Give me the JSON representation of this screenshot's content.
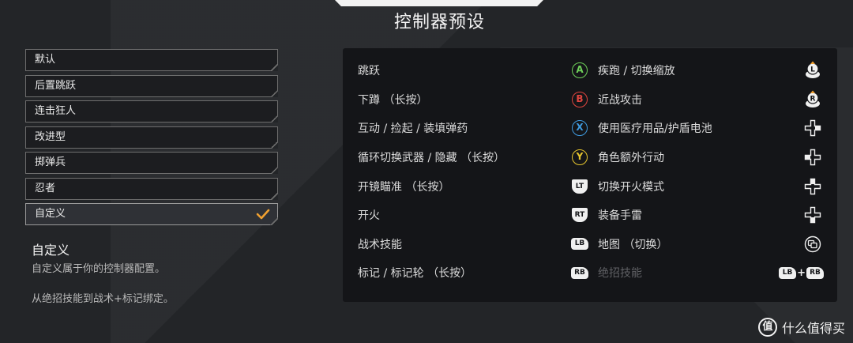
{
  "title": "控制器预设",
  "presets": [
    {
      "label": "默认"
    },
    {
      "label": "后置跳跃"
    },
    {
      "label": "连击狂人"
    },
    {
      "label": "改进型"
    },
    {
      "label": "掷弹兵"
    },
    {
      "label": "忍者"
    },
    {
      "label": "自定义",
      "selected": true
    }
  ],
  "accent_color": "#f0a030",
  "description": {
    "title": "自定义",
    "text": "自定义属于你的控制器配置。",
    "note": "从绝招技能到战术+标记绑定。"
  },
  "bindings_left": [
    {
      "action": "跳跃",
      "button": "A",
      "icon": "a-button-icon",
      "color": "#6fd15a"
    },
    {
      "action": "下蹲 （长按）",
      "button": "B",
      "icon": "b-button-icon",
      "color": "#e0453f"
    },
    {
      "action": "互动 / 捡起 / 装填弹药",
      "button": "X",
      "icon": "x-button-icon",
      "color": "#3f9be0"
    },
    {
      "action": "循环切换武器 / 隐藏 （长按）",
      "button": "Y",
      "icon": "y-button-icon",
      "color": "#e6c52e"
    },
    {
      "action": "开镜瞄准 （长按）",
      "button": "LT",
      "icon": "left-trigger-icon"
    },
    {
      "action": "开火",
      "button": "RT",
      "icon": "right-trigger-icon"
    },
    {
      "action": "战术技能",
      "button": "LB",
      "icon": "left-bumper-icon"
    },
    {
      "action": "标记 / 标记轮 （长按）",
      "button": "RB",
      "icon": "right-bumper-icon"
    }
  ],
  "bindings_right": [
    {
      "action": "疾跑 / 切换缩放",
      "button": "L",
      "icon": "left-stick-click-icon"
    },
    {
      "action": "近战攻击",
      "button": "R",
      "icon": "right-stick-click-icon"
    },
    {
      "action": "使用医疗用品/护盾电池",
      "icon": "dpad-right-icon",
      "dir": "right"
    },
    {
      "action": "角色额外行动",
      "icon": "dpad-left-icon",
      "dir": "left"
    },
    {
      "action": "切换开火模式",
      "icon": "dpad-up-icon",
      "dir": "up"
    },
    {
      "action": "装备手雷",
      "icon": "dpad-down-icon",
      "dir": "down"
    },
    {
      "action": "地图 （切换）",
      "icon": "view-button-icon"
    },
    {
      "action": "绝招技能",
      "combo_a": "LB",
      "combo_plus": "+",
      "combo_b": "RB",
      "icon": "lb-rb-combo-icon",
      "disabled": true
    }
  ],
  "watermark": {
    "text": "什么值得买",
    "logo": "值"
  }
}
